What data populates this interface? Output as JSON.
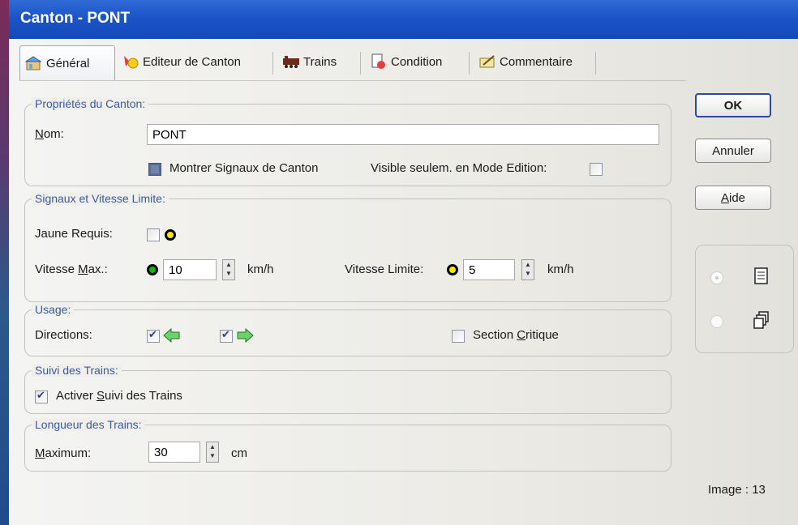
{
  "window": {
    "title": "Canton - PONT"
  },
  "tabs": [
    {
      "label": "Général",
      "icon": "general-icon"
    },
    {
      "label": "Editeur de Canton",
      "icon": "editor-icon"
    },
    {
      "label": "Trains",
      "icon": "trains-icon"
    },
    {
      "label": "Condition",
      "icon": "condition-icon"
    },
    {
      "label": "Commentaire",
      "icon": "comment-icon"
    }
  ],
  "canton_props": {
    "title": "Propriétés du Canton:",
    "name_label": "Nom:",
    "name_value": "PONT",
    "show_signals_label": "Montrer Signaux de Canton",
    "show_signals_checked": "partial",
    "visible_edit_label": "Visible seulem. en Mode Edition:",
    "visible_edit_checked": false
  },
  "signals": {
    "title": "Signaux et Vitesse Limite:",
    "yellow_required_label": "Jaune Requis:",
    "vmax_label": "Vitesse Max.:",
    "vmax_value": "10",
    "vmax_unit": "km/h",
    "vlimit_label": "Vitesse Limite:",
    "vlimit_value": "5",
    "vlimit_unit": "km/h",
    "colors": {
      "green": "#00c000",
      "yellow": "#ffe600"
    }
  },
  "usage": {
    "title": "Usage:",
    "directions_label": "Directions:",
    "left_checked": true,
    "right_checked": true,
    "critical_label": "Section Critique",
    "critical_checked": false
  },
  "tracking": {
    "title": "Suivi des Trains:",
    "enable_label": "Activer Suivi des Trains",
    "enable_checked": true
  },
  "length": {
    "title": "Longueur des Trains:",
    "max_label": "Maximum:",
    "max_value": "30",
    "unit": "cm"
  },
  "buttons": {
    "ok": "OK",
    "cancel": "Annuler",
    "help": "Aide"
  },
  "image_info": "Image : 13"
}
